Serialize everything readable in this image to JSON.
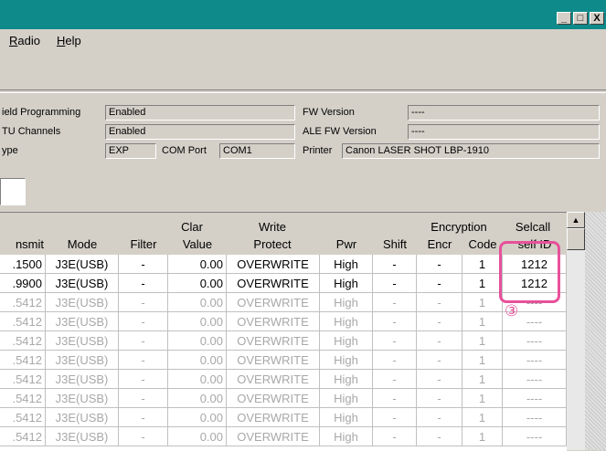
{
  "window": {
    "buttons": [
      "_",
      "□",
      "X"
    ]
  },
  "menu": [
    {
      "label": "Radio",
      "mnemonic": "R",
      "rest": "adio"
    },
    {
      "label": "Help",
      "mnemonic": "H",
      "rest": "elp"
    }
  ],
  "info": {
    "field_programming_label": "ield Programming",
    "field_programming_value": "Enabled",
    "tu_channels_label": "TU Channels",
    "tu_channels_value": "Enabled",
    "type_label": "ype",
    "type_value": "EXP",
    "com_port_label": "COM Port",
    "com_port_value": "COM1",
    "fw_version_label": "FW Version",
    "fw_version_value": "----",
    "ale_fw_version_label": "ALE FW Version",
    "ale_fw_version_value": "----",
    "printer_label": "Printer",
    "printer_value": "Canon LASER SHOT LBP-1910"
  },
  "table": {
    "headers": {
      "transmit": "nsmit",
      "mode": "Mode",
      "filter": "Filter",
      "clar_top": "Clar",
      "clar_bottom": "Value",
      "write_top": "Write",
      "write_bottom": "Protect",
      "pwr": "Pwr",
      "shift": "Shift",
      "encryption_top": "Encryption",
      "encr": "Encr",
      "code": "Code",
      "selcall_top": "Selcall",
      "selcall_bottom": "self ID"
    },
    "rows": [
      {
        "transmit": ".1500",
        "mode": "J3E(USB)",
        "filter": "-",
        "clar": "0.00",
        "protect": "OVERWRITE",
        "pwr": "High",
        "shift": "-",
        "encr": "-",
        "code": "1",
        "selcall": "1212",
        "dim": false
      },
      {
        "transmit": ".9900",
        "mode": "J3E(USB)",
        "filter": "-",
        "clar": "0.00",
        "protect": "OVERWRITE",
        "pwr": "High",
        "shift": "-",
        "encr": "-",
        "code": "1",
        "selcall": "1212",
        "dim": false
      },
      {
        "transmit": ".5412",
        "mode": "J3E(USB)",
        "filter": "-",
        "clar": "0.00",
        "protect": "OVERWRITE",
        "pwr": "High",
        "shift": "-",
        "encr": "-",
        "code": "1",
        "selcall": "----",
        "dim": true
      },
      {
        "transmit": ".5412",
        "mode": "J3E(USB)",
        "filter": "-",
        "clar": "0.00",
        "protect": "OVERWRITE",
        "pwr": "High",
        "shift": "-",
        "encr": "-",
        "code": "1",
        "selcall": "----",
        "dim": true
      },
      {
        "transmit": ".5412",
        "mode": "J3E(USB)",
        "filter": "-",
        "clar": "0.00",
        "protect": "OVERWRITE",
        "pwr": "High",
        "shift": "-",
        "encr": "-",
        "code": "1",
        "selcall": "----",
        "dim": true
      },
      {
        "transmit": ".5412",
        "mode": "J3E(USB)",
        "filter": "-",
        "clar": "0.00",
        "protect": "OVERWRITE",
        "pwr": "High",
        "shift": "-",
        "encr": "-",
        "code": "1",
        "selcall": "----",
        "dim": true
      },
      {
        "transmit": ".5412",
        "mode": "J3E(USB)",
        "filter": "-",
        "clar": "0.00",
        "protect": "OVERWRITE",
        "pwr": "High",
        "shift": "-",
        "encr": "-",
        "code": "1",
        "selcall": "----",
        "dim": true
      },
      {
        "transmit": ".5412",
        "mode": "J3E(USB)",
        "filter": "-",
        "clar": "0.00",
        "protect": "OVERWRITE",
        "pwr": "High",
        "shift": "-",
        "encr": "-",
        "code": "1",
        "selcall": "----",
        "dim": true
      },
      {
        "transmit": ".5412",
        "mode": "J3E(USB)",
        "filter": "-",
        "clar": "0.00",
        "protect": "OVERWRITE",
        "pwr": "High",
        "shift": "-",
        "encr": "-",
        "code": "1",
        "selcall": "----",
        "dim": true
      },
      {
        "transmit": ".5412",
        "mode": "J3E(USB)",
        "filter": "-",
        "clar": "0.00",
        "protect": "OVERWRITE",
        "pwr": "High",
        "shift": "-",
        "encr": "-",
        "code": "1",
        "selcall": "----",
        "dim": true
      }
    ]
  },
  "annotation": {
    "marker": "③",
    "color": "#e8509a"
  },
  "colors": {
    "titlebar": "#0f8a8a",
    "chrome": "#d4d0c8"
  }
}
